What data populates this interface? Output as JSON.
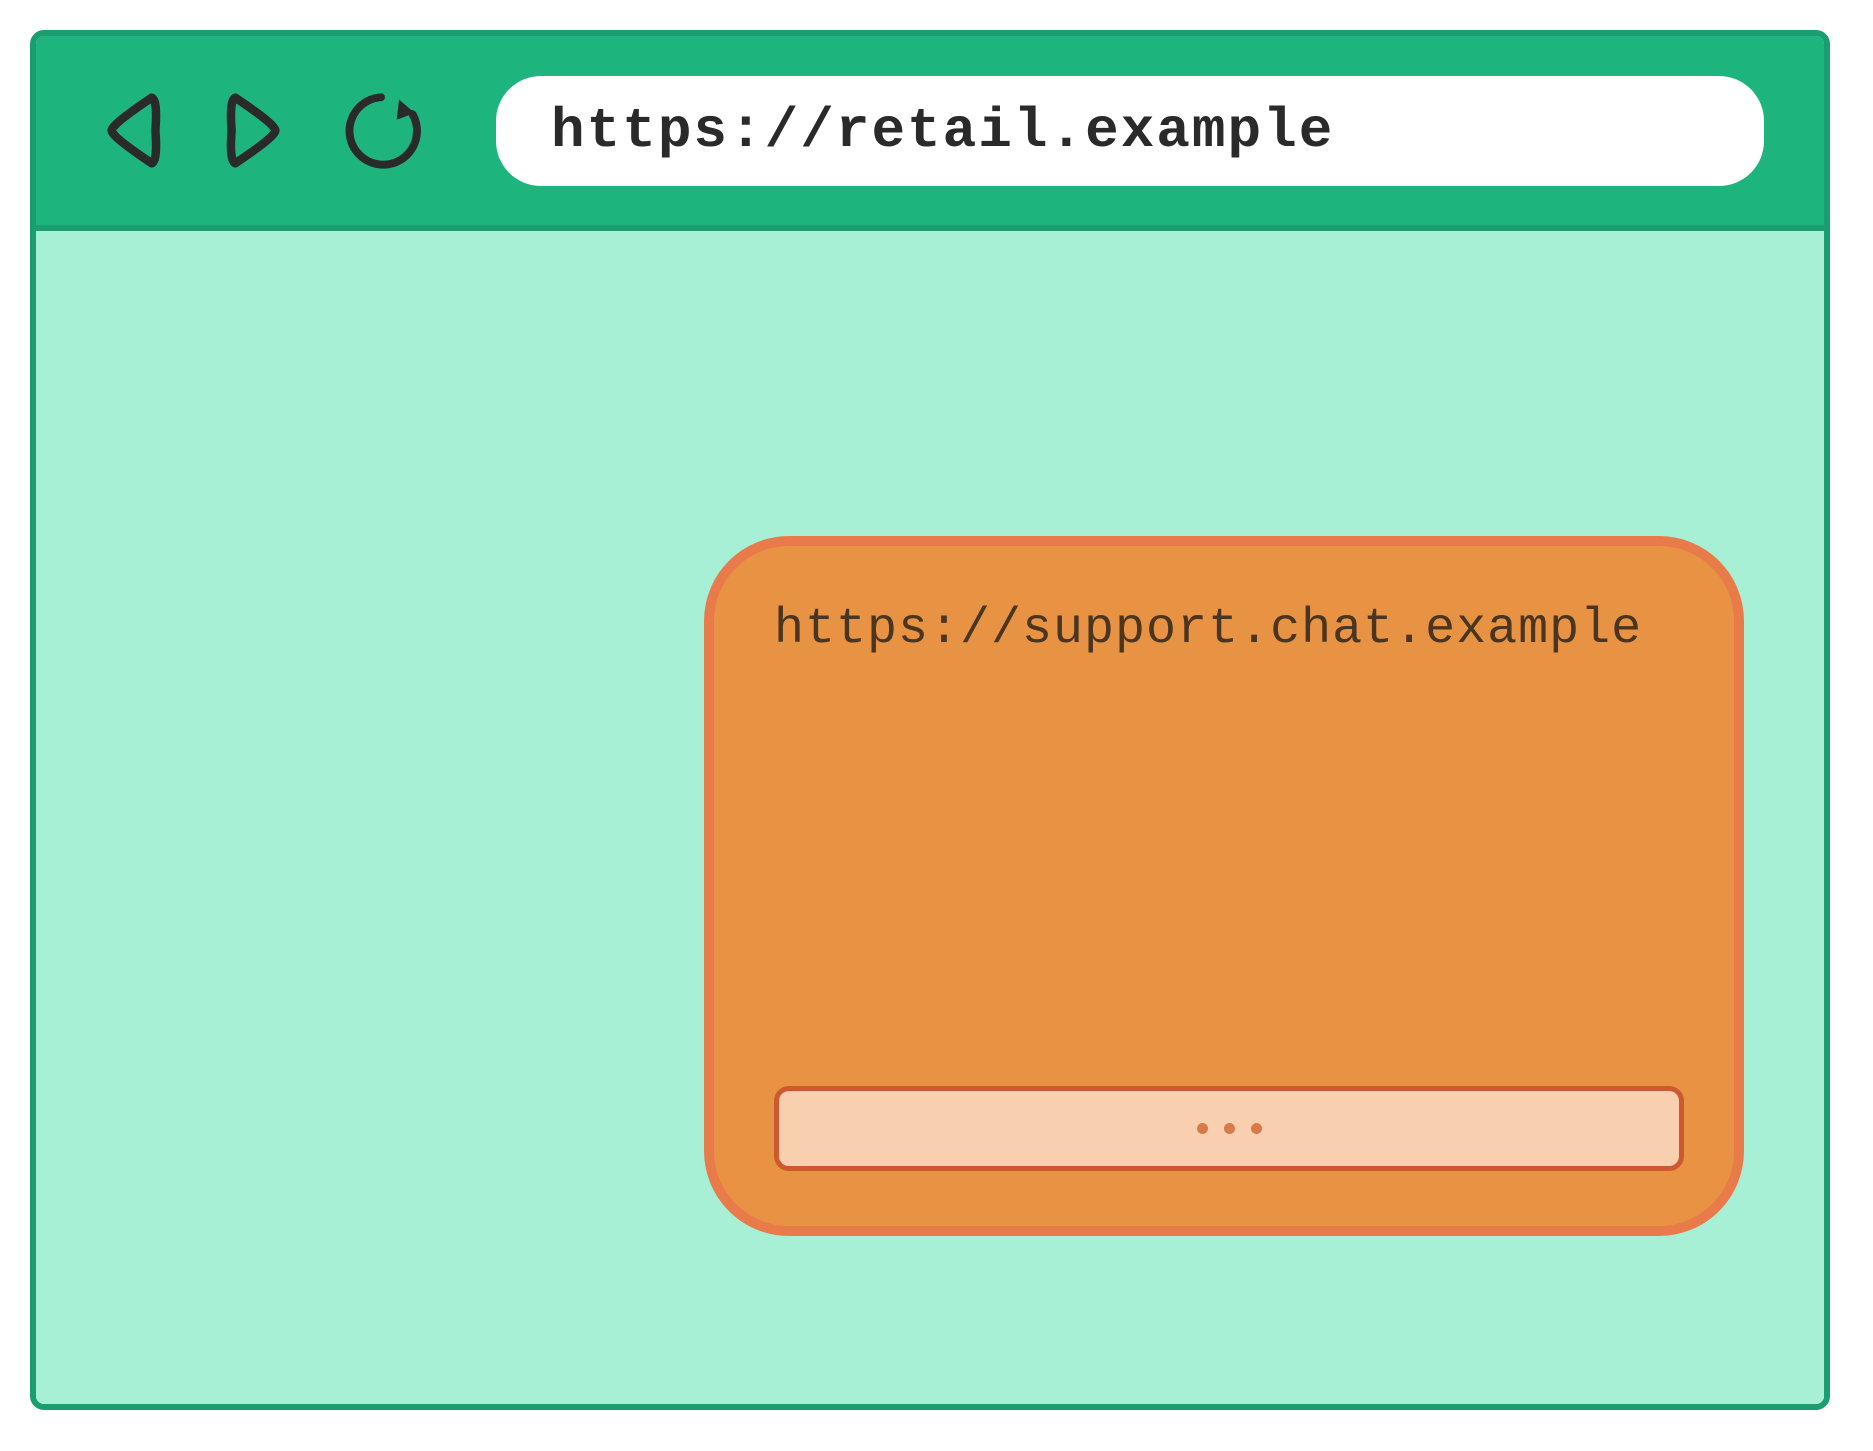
{
  "browser": {
    "url": "https://retail.example"
  },
  "chat_widget": {
    "url": "https://support.chat.example"
  },
  "colors": {
    "toolbar": "#1eb47e",
    "toolbar_border": "#1a9e70",
    "viewport": "#a8f0d5",
    "widget_bg": "#e89344",
    "widget_border": "#e97b4a",
    "input_bg": "#f9d0af",
    "input_border": "#cc5a2e"
  }
}
